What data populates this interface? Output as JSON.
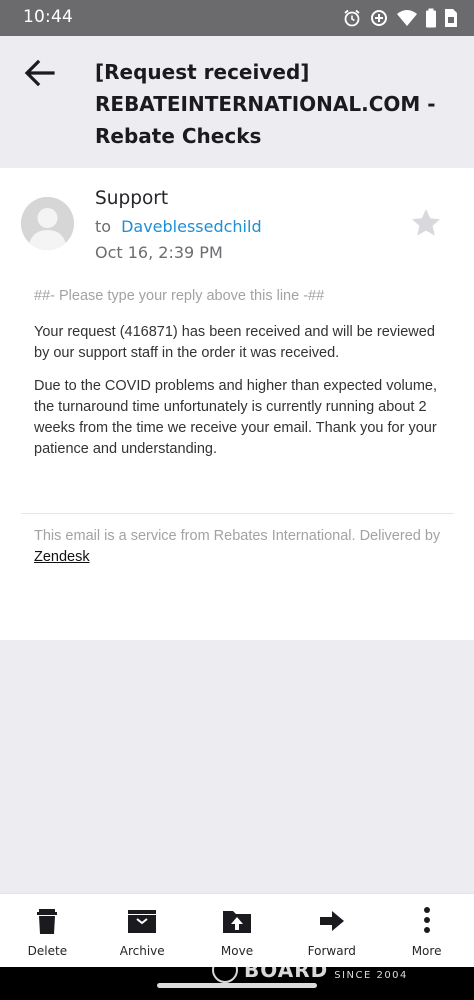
{
  "status_bar": {
    "time": "10:44",
    "icons": [
      "alarm-icon",
      "data-saver-icon",
      "wifi-icon",
      "battery-icon",
      "sim-icon"
    ]
  },
  "header": {
    "back_icon": "arrow-left-icon",
    "subject": "[Request received] REBATEINTERNATIONAL.COM - Rebate Checks"
  },
  "message": {
    "sender": "Support",
    "to_prefix": "to",
    "recipient": "Daveblessedchild",
    "date": "Oct 16, 2:39 PM",
    "starred": false,
    "reply_line": "##- Please type your reply above this line -##",
    "paragraphs": [
      "Your request (416871) has been received and will be reviewed by our support staff in the order it was received.",
      "Due to the COVID problems and higher than expected volume, the turnaround time unfortunately is currently running about 2 weeks from the time we receive your email. Thank you for your patience and understanding."
    ],
    "footer_text": "This email is a service from Rebates International. Delivered by",
    "footer_link": "Zendesk"
  },
  "toolbar": {
    "delete": "Delete",
    "archive": "Archive",
    "move": "Move",
    "forward": "Forward",
    "more": "More"
  },
  "watermark": {
    "text": "BOARD",
    "since": "SINCE 2004"
  },
  "colors": {
    "accent_link": "#1e8fd6",
    "status_bar": "#6b6b6e",
    "background": "#ededf1"
  }
}
